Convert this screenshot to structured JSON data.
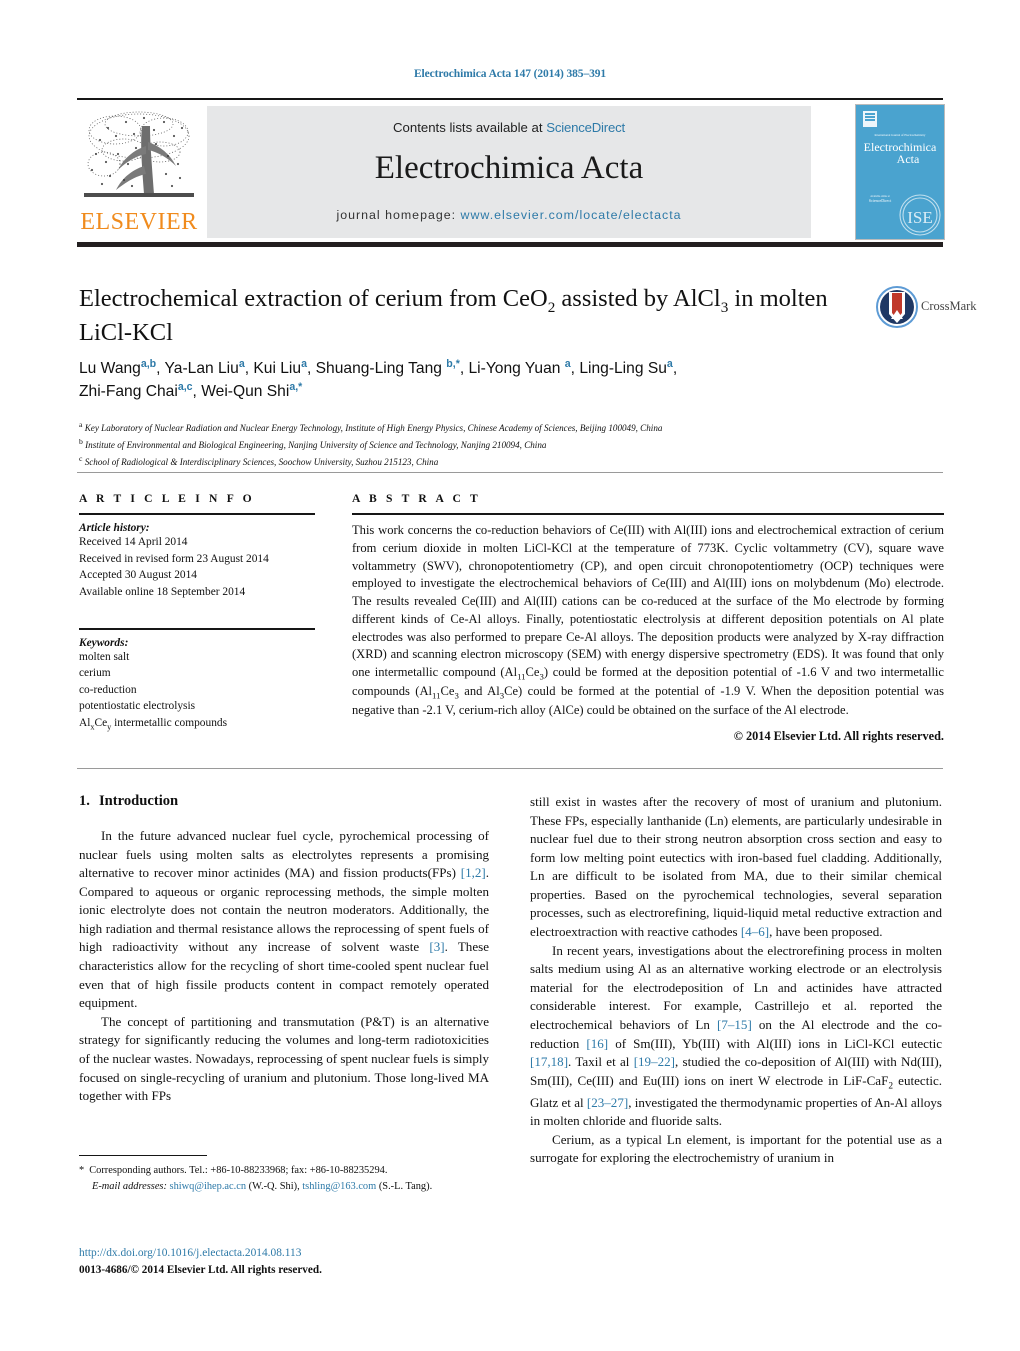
{
  "running_head": "Electrochimica Acta 147 (2014) 385–391",
  "masthead": {
    "contents_prefix": "Contents lists available at ",
    "sciencedirect": "ScienceDirect",
    "journal_title": "Electrochimica Acta",
    "homepage_prefix": "journal homepage:",
    "homepage_url": "www.elsevier.com/locate/electacta",
    "publisher_wordmark": "ELSEVIER",
    "cover_journal_line1": "Electrochimica",
    "cover_journal_line2": "Acta"
  },
  "article": {
    "title_part1": "Electrochemical extraction of cerium from CeO",
    "title_sub1": "2",
    "title_part2": " assisted by AlCl",
    "title_sub2": "3",
    "title_part3": " in molten LiCl-KCl",
    "crossmark_label": "CrossMark",
    "authors_line1": "Lu Wang",
    "authors": "Lu Wang a,b, Ya-Lan Liu a, Kui Liu a, Shuang-Ling Tang b,*, Li-Yong Yuan a, Ling-Ling Su a, Zhi-Fang Chai a,c, Wei-Qun Shi a,*",
    "affiliations": [
      {
        "marker": "a",
        "text": "Key Laboratory of Nuclear Radiation and Nuclear Energy Technology, Institute of High Energy Physics, Chinese Academy of Sciences, Beijing 100049, China"
      },
      {
        "marker": "b",
        "text": "Institute of Environmental and Biological Engineering, Nanjing University of Science and Technology, Nanjing 210094, China"
      },
      {
        "marker": "c",
        "text": "School of Radiological & Interdisciplinary Sciences, Soochow University, Suzhou 215123, China"
      }
    ]
  },
  "article_info": {
    "heading": "A R T I C L E   I N F O",
    "history_title": "Article history:",
    "history": [
      "Received 14 April 2014",
      "Received in revised form 23 August 2014",
      "Accepted 30 August 2014",
      "Available online 18 September 2014"
    ],
    "keywords_title": "Keywords:",
    "keywords": [
      "molten salt",
      "cerium",
      "co-reduction",
      "potentiostatic electrolysis"
    ],
    "keyword_last_prefix": "Al",
    "keyword_last_sub1": "x",
    "keyword_last_mid": "Ce",
    "keyword_last_sub2": "y",
    "keyword_last_suffix": " intermetallic compounds"
  },
  "abstract": {
    "heading": "A B S T R A C T",
    "text": "This work concerns the co-reduction behaviors of Ce(III) with Al(III) ions and electrochemical extraction of cerium from cerium dioxide in molten LiCl-KCl at the temperature of 773K. Cyclic voltammetry (CV), square wave voltammetry (SWV), chronopotentiometry (CP), and open circuit chronopotentiometry (OCP) techniques were employed to investigate the electrochemical behaviors of Ce(III) and Al(III) ions on molybdenum (Mo) electrode. The results revealed Ce(III) and Al(III) cations can be co-reduced at the surface of the Mo electrode by forming different kinds of Ce-Al alloys. Finally, potentiostatic electrolysis at different deposition potentials on Al plate electrodes was also performed to prepare Ce-Al alloys. The deposition products were analyzed by X-ray diffraction (XRD) and scanning electron microscopy (SEM) with energy dispersive spectrometry (EDS). It was found that only one intermetallic compound (Al11Ce3) could be formed at the deposition potential of -1.6 V and two intermetallic compounds (Al11Ce3 and Al3Ce) could be formed at the potential of -1.9 V. When the deposition potential was negative than -2.1 V, cerium-rich alloy (AlCe) could be obtained on the surface of the Al electrode.",
    "copyright": "© 2014 Elsevier Ltd. All rights reserved."
  },
  "body": {
    "section_number": "1.",
    "section_title": "Introduction",
    "left_paragraphs": [
      "In the future advanced nuclear fuel cycle, pyrochemical processing of nuclear fuels using molten salts as electrolytes represents a promising alternative to recover minor actinides (MA) and fission products(FPs) [1,2]. Compared to aqueous or organic reprocessing methods, the simple molten ionic electrolyte does not contain the neutron moderators. Additionally, the high radiation and thermal resistance allows the reprocessing of spent fuels of high radioactivity without any increase of solvent waste [3]. These characteristics allow for the recycling of short time-cooled spent nuclear fuel even that of high fissile products content in compact remotely operated equipment.",
      "The concept of partitioning and transmutation (P&T) is an alternative strategy for significantly reducing the volumes and long-term radiotoxicities of the nuclear wastes. Nowadays, reprocessing of spent nuclear fuels is simply focused on single-recycling of uranium and plutonium. Those long-lived MA together with FPs"
    ],
    "right_paragraphs": [
      "still exist in wastes after the recovery of most of uranium and plutonium. These FPs, especially lanthanide (Ln) elements, are particularly undesirable in nuclear fuel due to their strong neutron absorption cross section and easy to form low melting point eutectics with iron-based fuel cladding. Additionally, Ln are difficult to be isolated from MA, due to their similar chemical properties. Based on the pyrochemical technologies, several separation processes, such as electrorefining, liquid-liquid metal reductive extraction and electroextraction with reactive cathodes [4–6], have been proposed.",
      "In recent years, investigations about the electrorefining process in molten salts medium using Al as an alternative working electrode or an electrolysis material for the electrodeposition of Ln and actinides have attracted considerable interest. For example, Castrillejo et al. reported the electrochemical behaviors of Ln [7–15] on the Al electrode and the co-reduction [16] of Sm(III), Yb(III) with Al(III) ions in LiCl-KCl eutectic [17,18]. Taxil et al [19–22], studied the co-deposition of Al(III) with Nd(III), Sm(III), Ce(III) and Eu(III) ions on inert W electrode in LiF-CaF2 eutectic. Glatz et al [23–27], investigated the thermodynamic properties of An-Al alloys in molten chloride and fluoride salts.",
      "Cerium, as a typical Ln element, is important for the potential use as a surrogate for exploring the electrochemistry of uranium in"
    ]
  },
  "footnote": {
    "star": "*",
    "corresponding": "Corresponding authors. Tel.: +86-10-88233968; fax: +86-10-88235294.",
    "email_label": "E-mail addresses:",
    "email1": "shiwq@ihep.ac.cn",
    "email1_owner": "(W.-Q. Shi),",
    "email2": "tshling@163.com",
    "email2_owner": "(S.-L. Tang)."
  },
  "doi": {
    "url": "http://dx.doi.org/10.1016/j.electacta.2014.08.113",
    "issn_line": "0013-4686/© 2014 Elsevier Ltd. All rights reserved."
  },
  "colors": {
    "link": "#2e7aa8",
    "elsevier_orange": "#F08B1D",
    "cover_blue": "#4aa3cf",
    "rule_dark": "#231f20",
    "masthead_gray": "#e6e7e8"
  }
}
